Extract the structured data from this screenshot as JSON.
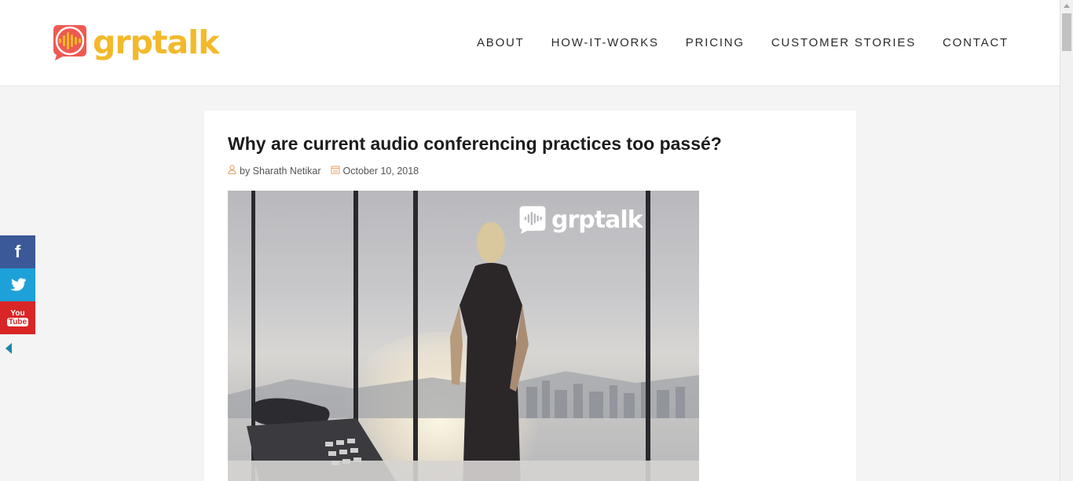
{
  "brand": {
    "name": "grptalk",
    "primary_color": "#f2b92a",
    "mark_color": "#ee5a52"
  },
  "nav": {
    "items": [
      {
        "label": "ABOUT"
      },
      {
        "label": "HOW-IT-WORKS"
      },
      {
        "label": "PRICING"
      },
      {
        "label": "CUSTOMER STORIES"
      },
      {
        "label": "CONTACT"
      }
    ]
  },
  "post": {
    "title": "Why are current audio conferencing practices too passé?",
    "author": "by Sharath Netikar",
    "date": "October 10, 2018",
    "author_icon": "user-icon",
    "date_icon": "calendar-icon",
    "image_logo_text": "grptalk"
  },
  "social": {
    "facebook_label": "f",
    "facebook_icon": "facebook-icon",
    "twitter_icon": "twitter-icon",
    "youtube_top": "You",
    "youtube_bottom": "Tube",
    "colors": {
      "facebook": "#3b5998",
      "twitter": "#1da1d8",
      "youtube": "#d92526"
    }
  }
}
